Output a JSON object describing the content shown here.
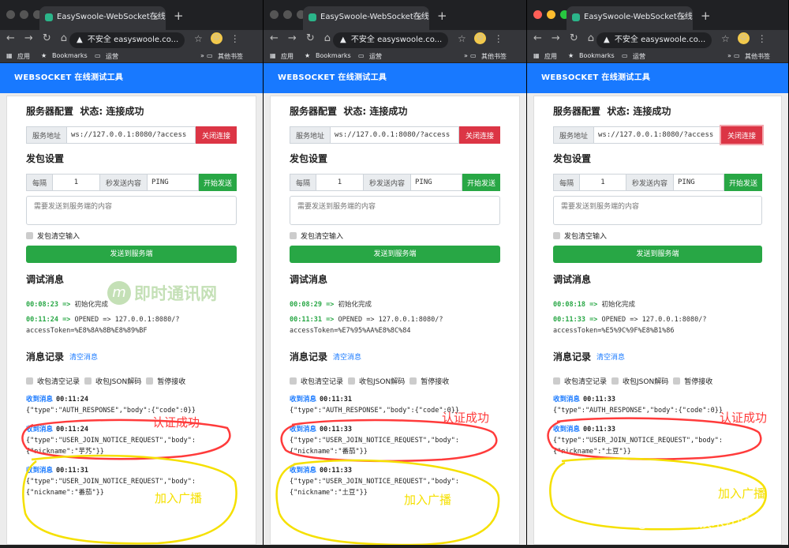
{
  "browser": {
    "tab_title": "EasySwoole-WebSocket在线测试",
    "close_tab": "×",
    "new_tab": "+",
    "insecure": "不安全",
    "url": "easyswoole.co...",
    "bookmarks": {
      "apps": "应用",
      "bookmarks": "Bookmarks",
      "folder": "运营",
      "more": "»",
      "others": "其他书签"
    }
  },
  "app": {
    "header": "WEBSOCKET  在线测试工具",
    "server_config": "服务器配置",
    "status_label": "状态:",
    "status_value": "连接成功",
    "server_addr_label": "服务地址",
    "server_addr_value": "ws://127.0.0.1:8080/?access",
    "close_button": "关闭连接",
    "send_settings": "发包设置",
    "every_label": "每隔",
    "interval_value": "1",
    "seconds_send_label": "秒发送内容",
    "ping_value": "PING",
    "start_button": "开始发送",
    "textarea_placeholder": "需要发送到服务端的内容",
    "clear_input_label": "发包清空输入",
    "send_to_server": "发送到服务端",
    "debug_title": "调试消息",
    "records_title": "消息记录",
    "clear_messages": "清空消息",
    "opt_clear_records": "收包清空记录",
    "opt_json_decode": "收包JSON解码",
    "opt_pause": "暂停接收",
    "received": "收到消息",
    "arrow": "=>",
    "init_done": "初始化完成"
  },
  "windows": [
    {
      "debug_times": [
        "00:08:23",
        "00:11:24"
      ],
      "opened_line": "OPENED => 127.0.0.1:8080/?",
      "token_line": "accessToken=%E8%8A%8B%E8%89%BF",
      "messages": [
        {
          "time": "00:11:24",
          "body1": "{\"type\":\"AUTH_RESPONSE\",\"body\":{\"code\":0}}",
          "body2": ""
        },
        {
          "time": "00:11:24",
          "body1": "{\"type\":\"USER_JOIN_NOTICE_REQUEST\",\"body\":",
          "body2": "{\"nickname\":\"芋艿\"}}"
        },
        {
          "time": "00:11:31",
          "body1": "{\"type\":\"USER_JOIN_NOTICE_REQUEST\",\"body\":",
          "body2": "{\"nickname\":\"番茄\"}}"
        }
      ]
    },
    {
      "debug_times": [
        "00:08:29",
        "00:11:31"
      ],
      "opened_line": "OPENED => 127.0.0.1:8080/?",
      "token_line": "accessToken=%E7%95%AA%E8%8C%84",
      "messages": [
        {
          "time": "00:11:31",
          "body1": "{\"type\":\"AUTH_RESPONSE\",\"body\":{\"code\":0}}",
          "body2": ""
        },
        {
          "time": "00:11:33",
          "body1": "{\"type\":\"USER_JOIN_NOTICE_REQUEST\",\"body\":",
          "body2": "{\"nickname\":\"番茄\"}}"
        },
        {
          "time": "00:11:33",
          "body1": "{\"type\":\"USER_JOIN_NOTICE_REQUEST\",\"body\":",
          "body2": "{\"nickname\":\"土豆\"}}"
        }
      ]
    },
    {
      "debug_times": [
        "00:08:18",
        "00:11:33"
      ],
      "opened_line": "OPENED => 127.0.0.1:8080/?",
      "token_line": "accessToken=%E5%9C%9F%E8%B1%86",
      "messages": [
        {
          "time": "00:11:33",
          "body1": "{\"type\":\"AUTH_RESPONSE\",\"body\":{\"code\":0}}",
          "body2": ""
        },
        {
          "time": "00:11:33",
          "body1": "{\"type\":\"USER_JOIN_NOTICE_REQUEST\",\"body\":",
          "body2": "{\"nickname\":\"土豆\"}}"
        }
      ]
    }
  ],
  "annotations": {
    "auth_success": "认证成功",
    "join_broadcast": "加入广播",
    "logo_text": "即时通讯网",
    "watermark": "@稀土掘金技术社区"
  },
  "colors": {
    "header_blue": "#1879ff",
    "danger_red": "#dc3545",
    "success_green": "#28a745",
    "annotation_red": "#ff3b3b",
    "annotation_yellow": "#f5e000"
  }
}
